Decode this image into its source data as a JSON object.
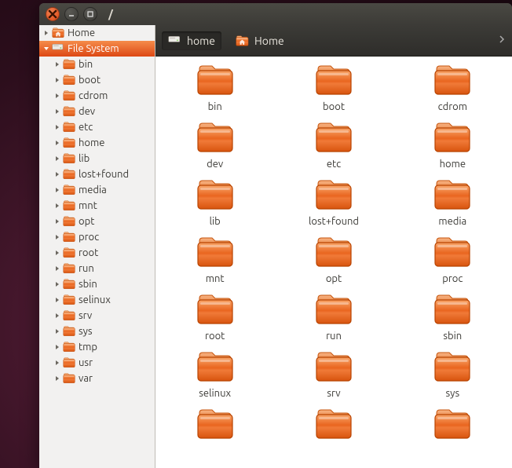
{
  "window": {
    "title": "/"
  },
  "sidebar": {
    "places": [
      {
        "label": "Home",
        "icon": "home-folder",
        "selected": false,
        "expandable": true,
        "expanded": false
      },
      {
        "label": "File System",
        "icon": "disk",
        "selected": true,
        "expandable": true,
        "expanded": true
      }
    ],
    "fs_children": [
      {
        "label": "bin"
      },
      {
        "label": "boot"
      },
      {
        "label": "cdrom"
      },
      {
        "label": "dev"
      },
      {
        "label": "etc"
      },
      {
        "label": "home"
      },
      {
        "label": "lib"
      },
      {
        "label": "lost+found"
      },
      {
        "label": "media"
      },
      {
        "label": "mnt"
      },
      {
        "label": "opt"
      },
      {
        "label": "proc"
      },
      {
        "label": "root"
      },
      {
        "label": "run"
      },
      {
        "label": "sbin"
      },
      {
        "label": "selinux"
      },
      {
        "label": "srv"
      },
      {
        "label": "sys"
      },
      {
        "label": "tmp"
      },
      {
        "label": "usr"
      },
      {
        "label": "var"
      }
    ]
  },
  "pathbar": {
    "crumbs": [
      {
        "label": "home",
        "icon": "disk"
      },
      {
        "label": "Home",
        "icon": "home-folder"
      }
    ]
  },
  "grid": {
    "items": [
      {
        "label": "bin"
      },
      {
        "label": "boot"
      },
      {
        "label": "cdrom"
      },
      {
        "label": "dev"
      },
      {
        "label": "etc"
      },
      {
        "label": "home"
      },
      {
        "label": "lib"
      },
      {
        "label": "lost+found"
      },
      {
        "label": "media"
      },
      {
        "label": "mnt"
      },
      {
        "label": "opt"
      },
      {
        "label": "proc"
      },
      {
        "label": "root"
      },
      {
        "label": "run"
      },
      {
        "label": "sbin"
      },
      {
        "label": "selinux"
      },
      {
        "label": "srv"
      },
      {
        "label": "sys"
      }
    ]
  }
}
